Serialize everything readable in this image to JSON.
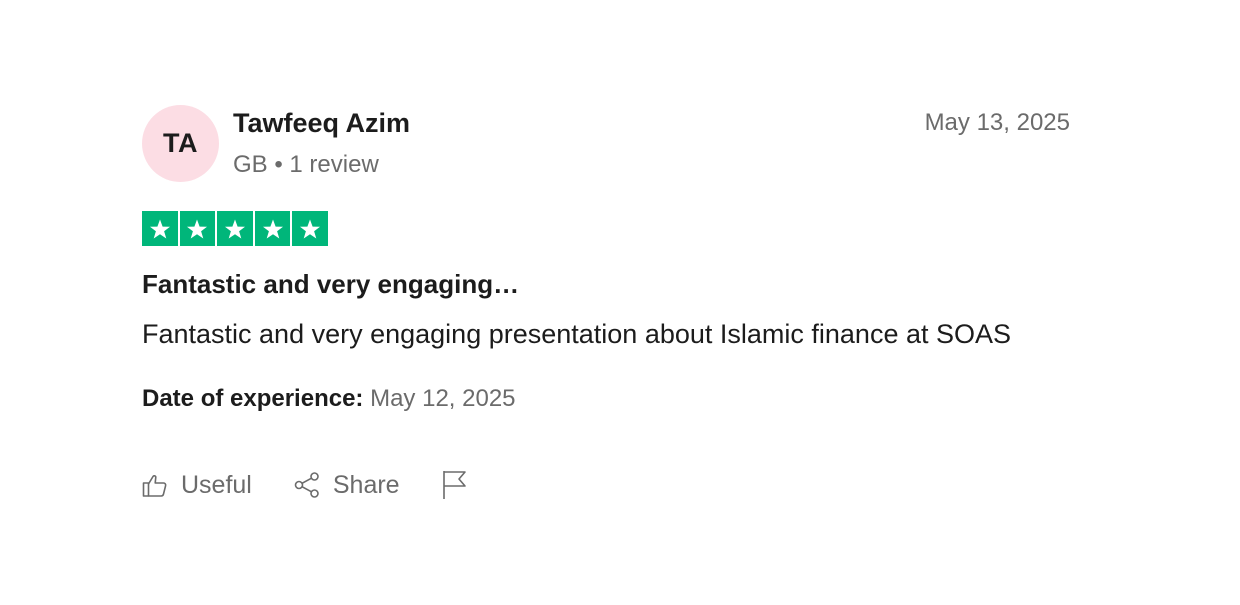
{
  "reviewer": {
    "initials": "TA",
    "name": "Tawfeeq Azim",
    "meta": "GB • 1 review",
    "avatar_color": "#fcdde4"
  },
  "review": {
    "date": "May 13, 2025",
    "rating": 5,
    "rating_max": 5,
    "star_color": "#00b67a",
    "title": "Fantastic and very engaging…",
    "body": "Fantastic and very engaging presentation about Islamic finance at SOAS",
    "experience_label": "Date of experience:",
    "experience_date": "May 12, 2025"
  },
  "actions": {
    "useful_label": "Useful",
    "useful_icon": "thumbs-up-icon",
    "share_label": "Share",
    "share_icon": "share-icon",
    "report_icon": "flag-icon"
  }
}
